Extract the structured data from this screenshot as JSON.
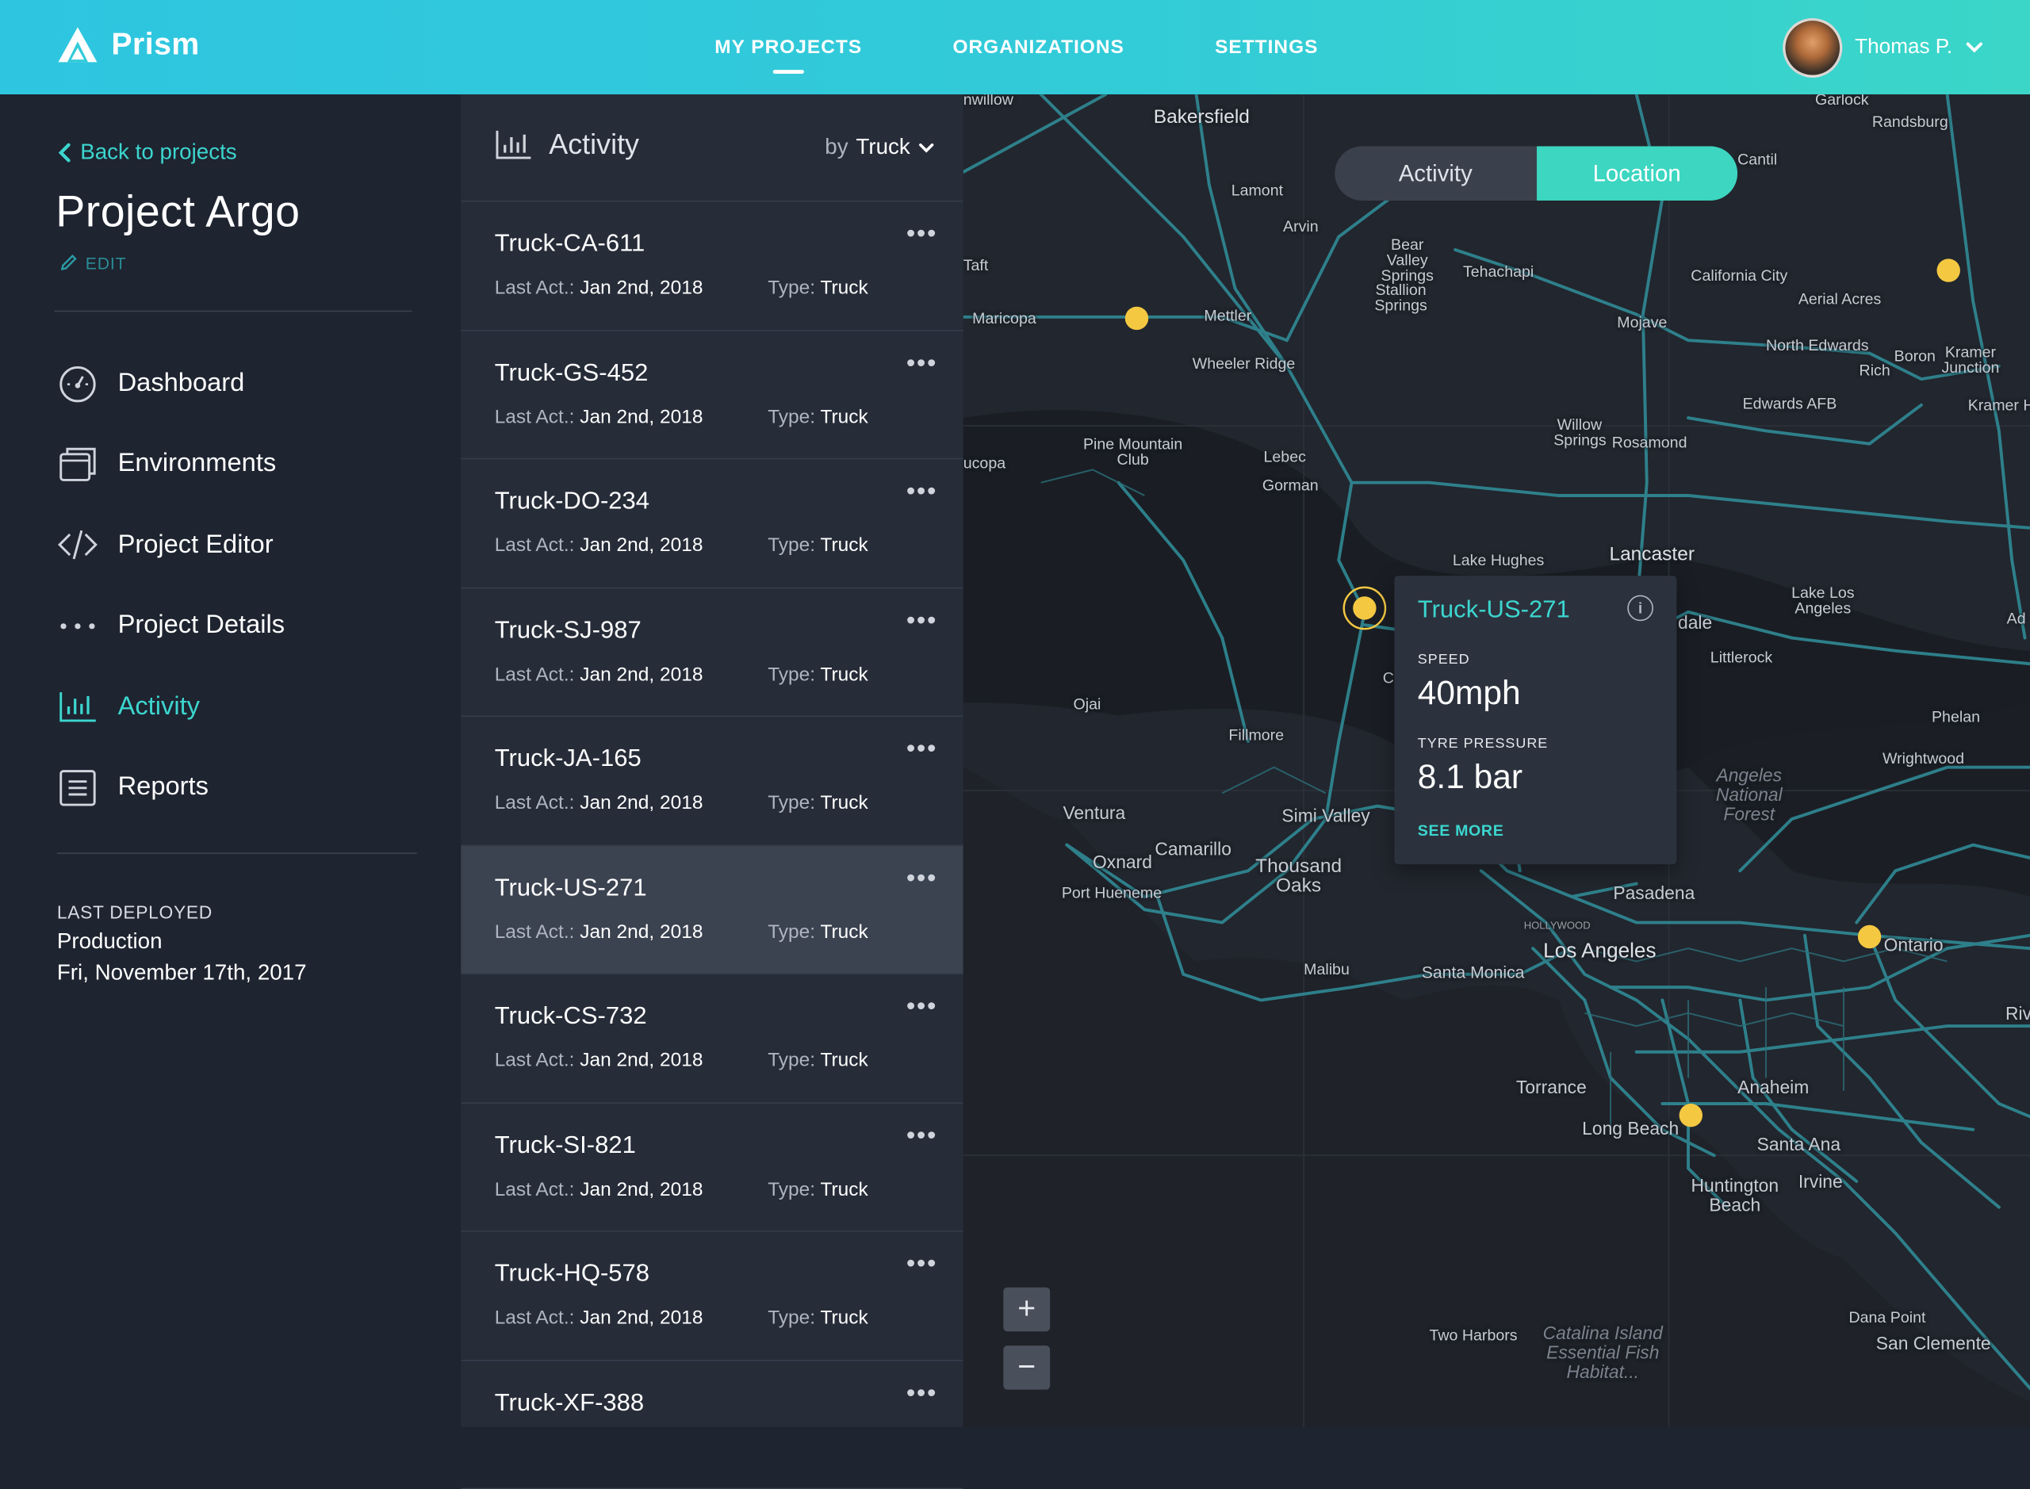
{
  "app": {
    "name": "Prism"
  },
  "nav": {
    "items": [
      "MY PROJECTS",
      "ORGANIZATIONS",
      "SETTINGS"
    ],
    "active": "MY PROJECTS"
  },
  "user": {
    "name": "Thomas P."
  },
  "sidebar": {
    "back_label": "Back to projects",
    "project_title": "Project Argo",
    "edit_label": "EDIT",
    "menu": [
      {
        "label": "Dashboard",
        "icon": "dashboard-icon"
      },
      {
        "label": "Environments",
        "icon": "environments-icon"
      },
      {
        "label": "Project Editor",
        "icon": "code-icon"
      },
      {
        "label": "Project Details",
        "icon": "more-dots-icon"
      },
      {
        "label": "Activity",
        "icon": "bar-chart-icon",
        "active": true
      },
      {
        "label": "Reports",
        "icon": "reports-icon"
      }
    ],
    "deploy": {
      "label": "LAST DEPLOYED",
      "env": "Production",
      "date": "Fri, November 17th, 2017"
    }
  },
  "list": {
    "title": "Activity",
    "by_label": "by",
    "by_value": "Truck",
    "meta_last_label": "Last Act.:",
    "meta_type_label": "Type:",
    "items": [
      {
        "name": "Truck-CA-611",
        "last": "Jan 2nd, 2018",
        "type": "Truck"
      },
      {
        "name": "Truck-GS-452",
        "last": "Jan 2nd, 2018",
        "type": "Truck"
      },
      {
        "name": "Truck-DO-234",
        "last": "Jan 2nd, 2018",
        "type": "Truck"
      },
      {
        "name": "Truck-SJ-987",
        "last": "Jan 2nd, 2018",
        "type": "Truck"
      },
      {
        "name": "Truck-JA-165",
        "last": "Jan 2nd, 2018",
        "type": "Truck"
      },
      {
        "name": "Truck-US-271",
        "last": "Jan 2nd, 2018",
        "type": "Truck",
        "selected": true
      },
      {
        "name": "Truck-CS-732",
        "last": "Jan 2nd, 2018",
        "type": "Truck"
      },
      {
        "name": "Truck-SI-821",
        "last": "Jan 2nd, 2018",
        "type": "Truck"
      },
      {
        "name": "Truck-HQ-578",
        "last": "Jan 2nd, 2018",
        "type": "Truck"
      },
      {
        "name": "Truck-XF-388",
        "last": "",
        "type": ""
      }
    ]
  },
  "map": {
    "toggle": [
      "Activity",
      "Location"
    ],
    "toggle_active": "Location",
    "popup": {
      "title": "Truck-US-271",
      "speed_label": "SPEED",
      "speed_value": "40mph",
      "pressure_label": "TYRE PRESSURE",
      "pressure_value": "8.1 bar",
      "more_label": "SEE MORE"
    },
    "zoom_in": "+",
    "zoom_out": "−",
    "place_labels": [
      "Bakersfield",
      "Lamont",
      "Arvin",
      "Bear Valley Springs",
      "Tehachapi",
      "Stallion Springs",
      "Taft",
      "Maricopa",
      "Mettler",
      "Wheeler Ridge",
      "Mojave",
      "California City",
      "Aerial Acres",
      "North Edwards",
      "Boron",
      "Kramer Junction",
      "Rich",
      "Edwards AFB",
      "Kramer H",
      "Garlock",
      "Randsburg",
      "Cantil",
      "Pine Mountain Club",
      "Lebec",
      "Gorman",
      "Willow Springs",
      "Rosamond",
      "ucopa",
      "Lake Hughes",
      "Lancaster",
      "Lake Los Angeles",
      "dale",
      "Littlerock",
      "Ojai",
      "Fillmore",
      "Phelan",
      "Wrightwood",
      "Angeles National Forest",
      "Ventura",
      "Simi Valley",
      "Oxnard",
      "Camarillo",
      "Thousand Oaks",
      "Port Hueneme",
      "Pasadena",
      "HOLLYWOOD",
      "Los Angeles",
      "Ontario",
      "Malibu",
      "Santa Monica",
      "Riv",
      "Torrance",
      "Anaheim",
      "Long Beach",
      "Santa Ana",
      "Huntington Beach",
      "Irvine",
      "Two Harbors",
      "Catalina Island Essential Fish Habitat...",
      "Dana Point",
      "San Clemente",
      "Ad",
      "nwillow",
      "C"
    ],
    "marker_color": "#f5c842"
  },
  "colors": {
    "accent": "#3cd6cf",
    "background": "#1e2430",
    "selected_row": "#3b4250"
  }
}
